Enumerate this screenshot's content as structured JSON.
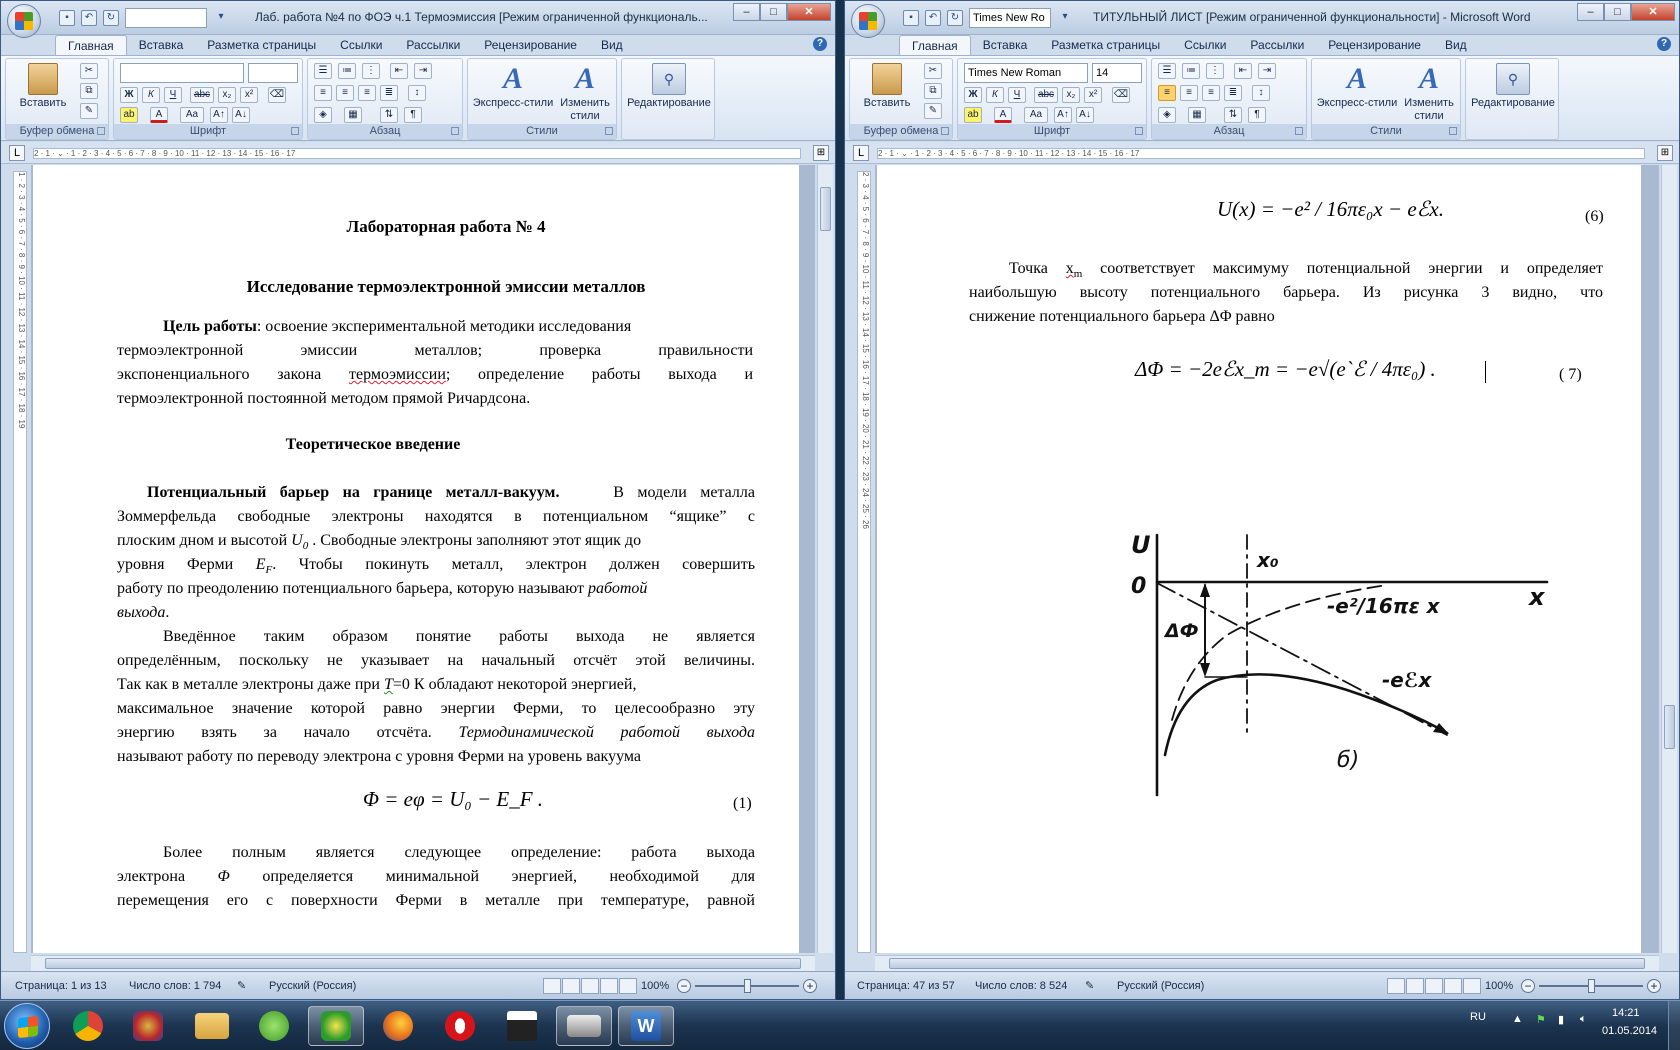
{
  "left": {
    "title": "Лаб. работа №4 по ФОЭ ч.1 Термоэмиссия [Режим ограниченной функциональ...",
    "qat_font": "",
    "tabs": [
      "Главная",
      "Вставка",
      "Разметка страницы",
      "Ссылки",
      "Рассылки",
      "Рецензирование",
      "Вид"
    ],
    "ribbon": {
      "paste": "Вставить",
      "styles1": "Экспресс-стили",
      "styles2a": "Изменить",
      "styles2b": "стили",
      "editing": "Редактирование",
      "groups": [
        "Буфер обмена",
        "Шрифт",
        "Абзац",
        "Стили"
      ],
      "font_name": "",
      "font_size": ""
    },
    "ruler": "2 · 1 · ⌄ · 1 · 2 · 3 · 4 · 5 · 6 · 7 · 8 · 9 · 10 · 11 · 12 · 13 · 14 · 15 · 16 · 17",
    "vruler": "1 · 2 · 3 · 4 · 5 · 6 · 7 · 8 · 9 · 10 · 11 · 12 · 13 · 14 · 15 · 16 · 17 · 18 · 19",
    "doc": {
      "title": "Лабораторная работа  № 4",
      "subtitle": "Исследование  термоэлектронной    эмиссии металлов",
      "aim_label": "Цель  работы",
      "aim_rest": ": освоение экспериментальной  методики исследования",
      "aim_l2": "термоэлектронной  эмиссии  металлов;  проверка  правильности",
      "aim_l3a": "экспоненциального  закона ",
      "aim_l3b": "термоэмиссии",
      "aim_l3c": ";  определение  работы  выхода  и",
      "aim_l4": "термоэлектронной постоянной методом  прямой Ричардсона.",
      "theory": "Теоретическое введение",
      "p1_bold": "Потенциальный барьер на границе металл-вакуум.",
      "p1_l1": "В модели металла",
      "p1_l2": "Зоммерфельда свободные электроны находятся в потенциальном “ящике” с",
      "p1_l3a": "плоским дном и высотой ",
      "p1_l3b": "U",
      "p1_l3c": "0",
      "p1_l3d": " . Свободные электроны заполняют этот ящик до",
      "p1_l4a": "уровня  Ферми  ",
      "p1_l4b": "E",
      "p1_l4c": "F",
      "p1_l4d": ".  Чтобы  покинуть  металл,  электрон  должен  совершить",
      "p1_l5a": "работу по преодолению потенциального барьера, которую называют ",
      "p1_l5b": "работой",
      "p1_l6": "выхода",
      "p1_l6b": ".",
      "p2_l1": "Введённое  таким  образом  понятие  работы  выхода  не  является",
      "p2_l2": "определённым, поскольку не указывает на начальный отсчёт этой величины.",
      "p2_l3a": "Так как в металле электроны даже при ",
      "p2_l3b": "T",
      "p2_l3c": "=0 К обладают некоторой энергией,",
      "p2_l4": "максимальное значение которой равно энергии Ферми, то целесообразно эту",
      "p2_l5a": "энергию  взять  за  начало  отсчёта. ",
      "p2_l5b": "Термодинамической  работой  выхода",
      "p2_l6": "называют работу по переводу электрона с уровня Ферми на уровень вакуума",
      "eq1": "Φ = eφ = U₀ − E_F .",
      "eq1_num": "(1)",
      "p3_l1": "Более  полным  является  следующее  определение:  работа  выхода",
      "p3_l2a": "электрона  ",
      "p3_l2b": "Φ",
      "p3_l2c": "  определяется  минимальной  энергией,  необходимой  для",
      "p3_l3": "перемещения  его  с  поверхности  Ферми  в  металле  при  температуре,  равной"
    },
    "status": {
      "page": "Страница: 1 из 13",
      "words": "Число слов: 1 794",
      "lang": "Русский (Россия)",
      "zoom": "100%"
    }
  },
  "right": {
    "title": "ТИТУЛЬНЫЙ ЛИСТ [Режим ограниченной функциональности] - Microsoft Word",
    "qat_font": "Times New Ro",
    "tabs": [
      "Главная",
      "Вставка",
      "Разметка страницы",
      "Ссылки",
      "Рассылки",
      "Рецензирование",
      "Вид"
    ],
    "ribbon": {
      "paste": "Вставить",
      "styles1": "Экспресс-стили",
      "styles2a": "Изменить",
      "styles2b": "стили",
      "editing": "Редактирование",
      "groups": [
        "Буфер обмена",
        "Шрифт",
        "Абзац",
        "Стили"
      ],
      "font_name": "Times New Roman",
      "font_size": "14"
    },
    "ruler": "2 · 1 · ⌄ · 1 · 2 · 3 · 4 · 5 · 6 · 7 · 8 · 9 · 10 · 11 · 12 · 13 · 14 · 15 · 16 · 17",
    "vruler": "2 · 3 · 4 · 5 · 6 · 7 · 8 · 9 · 10 · 11 · 12 · 13 · 14 · 15 · 16 · 17 · 18 · 19 · 20 · 21 · 22 · 23 · 24 · 25 · 26",
    "doc": {
      "eq6": "U(x) = −e² / 16πε₀x − eℰx.",
      "eq6_num": "(6)",
      "p_l1a": "Точка ",
      "p_l1b": "x",
      "p_l1c": "m",
      "p_l1d": " соответствует максимуму потенциальной энергии и определяет",
      "p_l2": "наибольшую  высоту  потенциального  барьера.  Из  рисунка  3  видно,  что",
      "p_l3": "снижение потенциального барьера  ΔΦ  равно",
      "eq7": "ΔΦ = −2eℰx_m = −e√(e`ℰ / 4πε₀) .",
      "eq7_num": "( 7)",
      "fig": {
        "U": "U",
        "O": "0",
        "x": "x",
        "x0": "x₀",
        "dphi": "ΔФ",
        "img": "-e²/16πε x",
        "lin": "-eℰx",
        "cap": "б)"
      }
    },
    "status": {
      "page": "Страница: 47 из 57",
      "words": "Число слов: 8 524",
      "lang": "Русский (Россия)",
      "zoom": "100%"
    }
  },
  "taskbar": {
    "lang": "RU",
    "time": "14:21",
    "date": "01.05.2014"
  }
}
